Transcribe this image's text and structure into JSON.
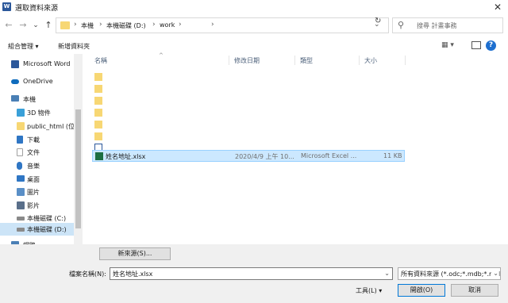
{
  "window": {
    "title": "選取資料來源",
    "app_icon": "W",
    "close_glyph": "✕"
  },
  "nav_buttons": {
    "back": "←",
    "forward": "→",
    "recent": "⌄",
    "up": "↑"
  },
  "address": {
    "crumbs": [
      "本機",
      "本機磁碟 (D:)",
      "work"
    ],
    "separator": "›",
    "dropdown": "⌄",
    "refresh": "↻"
  },
  "search": {
    "placeholder": "搜尋 計畫事務",
    "icon_glyph": "⚲"
  },
  "toolbar": {
    "organize": "組合管理 ▾",
    "new_folder": "新增資料夾",
    "views_glyph": "▦ ▾",
    "help": "?"
  },
  "sidebar": {
    "items": [
      {
        "label": "Microsoft Word",
        "icon": "word-icon",
        "color": "#2b579a"
      },
      {
        "label": "OneDrive",
        "icon": "cloud-icon",
        "color": "#0f6cbd"
      },
      {
        "label": "本機",
        "icon": "computer-icon",
        "color": "#4a7fb5"
      },
      {
        "label": "3D 物件",
        "icon": "cube-icon",
        "color": "#3aa0d8"
      },
      {
        "label": "public_html (位:",
        "icon": "folder-icon",
        "color": "#f7d774"
      },
      {
        "label": "下載",
        "icon": "download-icon",
        "color": "#2f76c4"
      },
      {
        "label": "文件",
        "icon": "document-icon",
        "color": "#a0a0a0"
      },
      {
        "label": "音樂",
        "icon": "music-icon",
        "color": "#2f76c4"
      },
      {
        "label": "桌面",
        "icon": "desktop-icon",
        "color": "#2f76c4"
      },
      {
        "label": "圖片",
        "icon": "pictures-icon",
        "color": "#5a8fc7"
      },
      {
        "label": "影片",
        "icon": "video-icon",
        "color": "#5a6f8a"
      },
      {
        "label": "本機磁碟 (C:)",
        "icon": "drive-icon",
        "color": "#8a8a8a"
      },
      {
        "label": "本機磁碟 (D:)",
        "icon": "drive-icon",
        "color": "#8a8a8a"
      },
      {
        "label": "網路",
        "icon": "network-icon",
        "color": "#4a7fb5"
      }
    ]
  },
  "columns": {
    "name": "名稱",
    "modified": "修改日期",
    "type": "類型",
    "size": "大小"
  },
  "files": [
    {
      "name": "",
      "modified": "",
      "type": "",
      "size": "",
      "icon": "folder-icon"
    },
    {
      "name": "",
      "modified": "",
      "type": "",
      "size": "",
      "icon": "folder-icon"
    },
    {
      "name": "",
      "modified": "",
      "type": "",
      "size": "",
      "icon": "folder-icon"
    },
    {
      "name": "",
      "modified": "",
      "type": "",
      "size": "",
      "icon": "folder-icon"
    },
    {
      "name": "",
      "modified": "",
      "type": "",
      "size": "",
      "icon": "folder-icon"
    },
    {
      "name": "",
      "modified": "",
      "type": "",
      "size": "",
      "icon": "folder-icon"
    },
    {
      "name": "",
      "modified": "",
      "type": "",
      "size": "",
      "icon": "word-doc-icon"
    },
    {
      "name": "姓名地址.xlsx",
      "modified": "2020/4/9 上午 10...",
      "type": "Microsoft Excel ...",
      "size": "11 KB",
      "icon": "excel-icon"
    }
  ],
  "buttons": {
    "new_source": "新來源(S)...",
    "open": "開啟(O)",
    "cancel": "取消"
  },
  "filename": {
    "label": "檔案名稱(N):",
    "value": "姓名地址.xlsx",
    "chevron": "⌄"
  },
  "filetype": {
    "value": "所有資料來源 (*.odc;*.mdb;*.mdb;*.a",
    "chevron": "⌄"
  },
  "tools": {
    "label": "工具(L) ▾"
  },
  "colors": {
    "selection": "#cce8ff",
    "selection_border": "#99d1ff",
    "folder": "#f7d774",
    "excel": "#1d6f42",
    "accent": "#0078d7"
  }
}
